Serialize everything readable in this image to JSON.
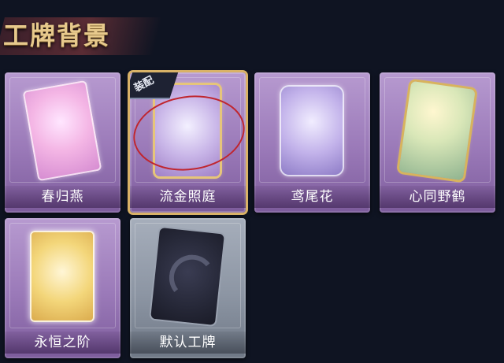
{
  "header": {
    "title": "工牌背景"
  },
  "cards": [
    {
      "label": "春归燕",
      "icon": "card-art-pink-icon"
    },
    {
      "label": "流金照庭",
      "icon": "card-art-gold-frame-icon",
      "badge": "装配"
    },
    {
      "label": "鸢尾花",
      "icon": "card-art-iris-icon"
    },
    {
      "label": "心同野鹤",
      "icon": "card-art-crane-icon"
    },
    {
      "label": "永恒之阶",
      "icon": "card-art-wings-icon"
    },
    {
      "label": "默认工牌",
      "icon": "card-art-default-icon"
    }
  ],
  "colors": {
    "background": "#0f1422",
    "title": "#e7c98c",
    "selected_border": "#d9b267",
    "highlight_ring": "#c0262f"
  }
}
